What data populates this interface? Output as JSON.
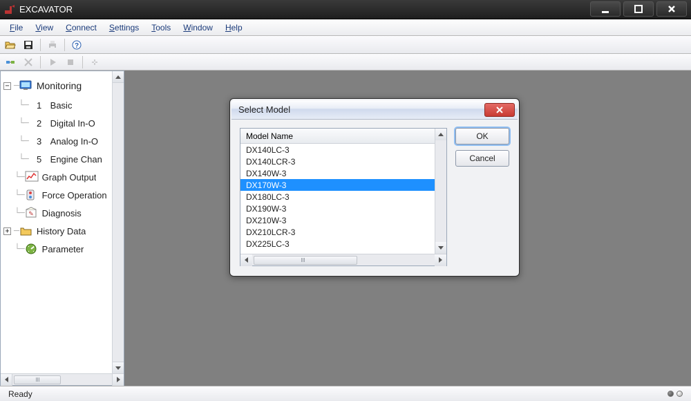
{
  "window": {
    "title": "EXCAVATOR"
  },
  "menu": {
    "items": [
      "File",
      "View",
      "Connect",
      "Settings",
      "Tools",
      "Window",
      "Help"
    ]
  },
  "tree": {
    "root": {
      "label": "Monitoring"
    },
    "children": [
      {
        "num": "1",
        "label": "Basic"
      },
      {
        "num": "2",
        "label": "Digital In-O"
      },
      {
        "num": "3",
        "label": "Analog In-O"
      },
      {
        "num": "5",
        "label": "Engine Chan"
      }
    ],
    "items": [
      {
        "label": "Graph Output"
      },
      {
        "label": "Force Operation"
      },
      {
        "label": "Diagnosis"
      },
      {
        "label": "History Data"
      },
      {
        "label": "Parameter"
      }
    ]
  },
  "dialog": {
    "title": "Select Model",
    "column": "Model Name",
    "ok": "OK",
    "cancel": "Cancel",
    "rows": [
      "DX140LC-3",
      "DX140LCR-3",
      "DX140W-3",
      "DX170W-3",
      "DX180LC-3",
      "DX190W-3",
      "DX210W-3",
      "DX210LCR-3",
      "DX225LC-3"
    ],
    "selected_index": 3
  },
  "status": {
    "text": "Ready"
  }
}
